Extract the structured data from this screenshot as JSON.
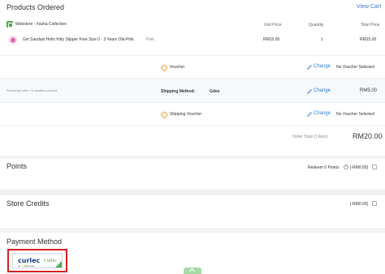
{
  "products": {
    "title": "Products Ordered",
    "view_cart": "View Cart",
    "store_name": "Webstore - Fasha Collection",
    "col_unit_price": "Unit Price",
    "col_quantity": "Quantity",
    "col_total_price": "Total Price",
    "item": {
      "name": "Girl Sandals Hello Kitty Slipper Free Size 0 - 3 Years Old-Pink",
      "variant": "Pink",
      "unit_price": "RM15.00",
      "quantity": "1",
      "total": "RM15.00"
    },
    "voucher": {
      "label": "Voucher",
      "change": "Change",
      "status": "No Voucher Selected"
    },
    "tax_note": "Product(s) with * is taxable product",
    "shipping": {
      "label": "Shipping Method:",
      "carrier": "Gdex",
      "change": "Change",
      "price": "RM5.00"
    },
    "shipping_voucher": {
      "label": "Shipping Voucher",
      "change": "Change",
      "status": "No Voucher Selected"
    },
    "order_total_label": "Order Total (1 Item):",
    "order_total": "RM20.00"
  },
  "points": {
    "title": "Points",
    "redeem_label": "Redeem 0 Points",
    "redeem_value": "[-RM0.00]"
  },
  "store_credits": {
    "title": "Store Credits",
    "value": "[-RM0.00]"
  },
  "payment": {
    "title": "Payment Method",
    "option_logo": "curlec",
    "option_by": "by ⚡Razorpay",
    "option_name": "Curlec"
  },
  "colors": {
    "accent_link": "#2f7fd0",
    "selected_border": "#d92020",
    "store_icon": "#4caf50",
    "tag_icon": "#f0a030"
  },
  "icons": [
    "store-icon",
    "tag-icon",
    "pencil-icon",
    "help-icon",
    "checkbox",
    "chevron-up-icon"
  ]
}
